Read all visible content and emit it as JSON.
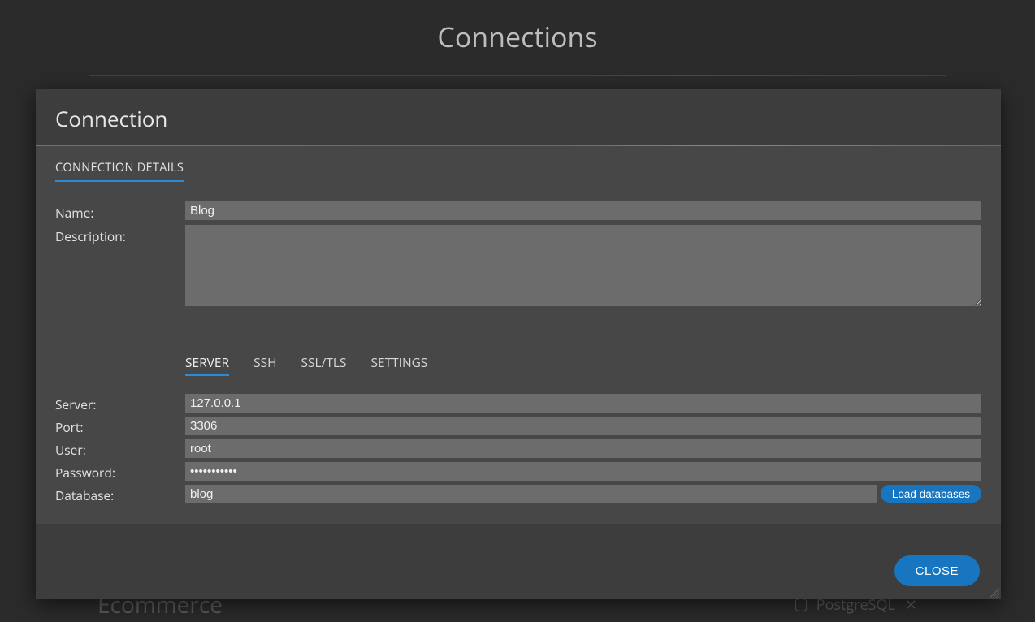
{
  "background": {
    "page_title": "Connections",
    "partial_item": {
      "name": "Ecommerce",
      "db_type": "PostgreSQL"
    }
  },
  "modal": {
    "title": "Connection",
    "section_tab": "CONNECTION DETAILS",
    "labels": {
      "name": "Name:",
      "description": "Description:",
      "server": "Server:",
      "port": "Port:",
      "user": "User:",
      "password": "Password:",
      "database": "Database:"
    },
    "values": {
      "name": "Blog",
      "description": "",
      "server": "127.0.0.1",
      "port": "3306",
      "user": "root",
      "password": "•••••••••••",
      "database": "blog"
    },
    "subtabs": {
      "server": "SERVER",
      "ssh": "SSH",
      "ssl": "SSL/TLS",
      "settings": "SETTINGS",
      "active": "server"
    },
    "buttons": {
      "load_databases": "Load databases",
      "close": "CLOSE"
    }
  }
}
